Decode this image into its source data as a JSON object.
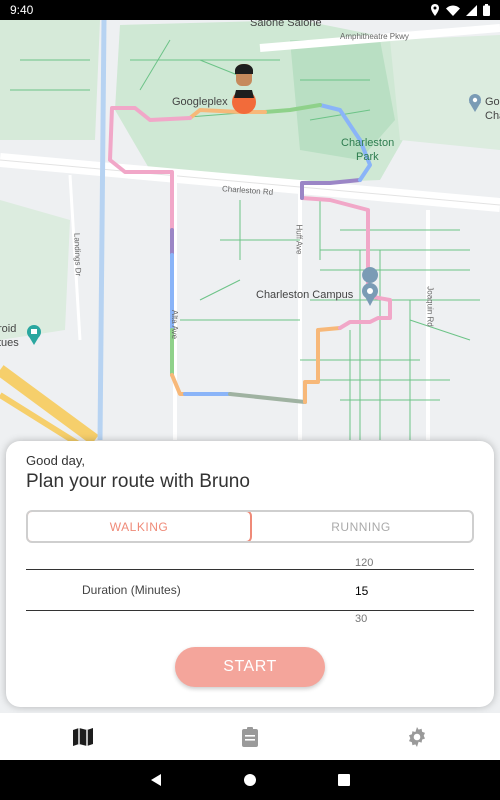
{
  "status_bar": {
    "time": "9:40"
  },
  "map": {
    "labels": {
      "salone": "Salone Salone",
      "amphitheatre": "Amphitheatre Pkwy",
      "googleplex": "Googleplex",
      "charleston_park_1": "Charleston",
      "charleston_park_2": "Park",
      "charleston_rd": "Charleston Rd",
      "charleston_campus": "Charleston Campus",
      "huff": "Huff Ave",
      "alta": "Alta Ave",
      "landings": "Landings Dr",
      "joaquin": "Joaquin Rd",
      "android_1": "roid",
      "android_2": "tues",
      "go_1": "Go",
      "go_2": "Cha"
    },
    "colors": {
      "pink": "#f1a7c8",
      "orange": "#f7b879",
      "blue": "#8ab4f8",
      "purple": "#9b86c6",
      "green": "#8fd18a",
      "gray": "#9fb2a1"
    }
  },
  "card": {
    "greeting": "Good day,",
    "title": "Plan your route with Bruno",
    "modes": {
      "walking": "WALKING",
      "running": "RUNNING"
    },
    "selected_mode": "walking",
    "duration_label": "Duration (Minutes)",
    "picker_values": {
      "prev": "120",
      "current": "15",
      "next": "30"
    },
    "start_label": "START",
    "accent_color": "#ef8a78",
    "button_color": "#f4a59b"
  },
  "bottom_nav": {
    "items": [
      {
        "icon": "map-icon",
        "active": true
      },
      {
        "icon": "clipboard-icon",
        "active": false
      },
      {
        "icon": "gear-icon",
        "active": false
      }
    ]
  }
}
